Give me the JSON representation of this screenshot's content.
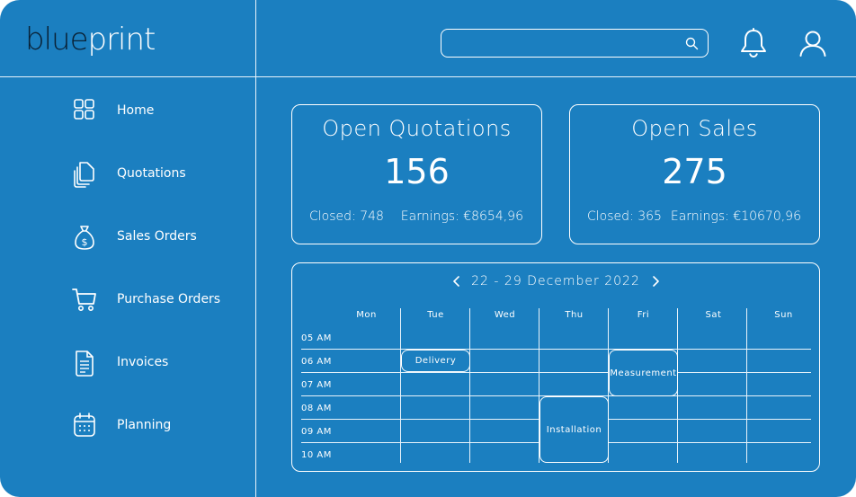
{
  "app": {
    "logo_part1": "blue",
    "logo_part2": "print"
  },
  "header": {
    "search_value": "",
    "search_placeholder": "",
    "icons": [
      "search-icon",
      "bell-icon",
      "user-icon"
    ]
  },
  "sidebar": {
    "items": [
      {
        "label": "Home",
        "icon": "grid-icon"
      },
      {
        "label": "Quotations",
        "icon": "documents-icon"
      },
      {
        "label": "Sales Orders",
        "icon": "money-bag-icon"
      },
      {
        "label": "Purchase Orders",
        "icon": "cart-icon"
      },
      {
        "label": "Invoices",
        "icon": "invoice-icon"
      },
      {
        "label": "Planning",
        "icon": "calendar-icon"
      }
    ]
  },
  "cards": {
    "quotations": {
      "title": "Open Quotations",
      "value": "156",
      "closed": "Closed: 748",
      "earnings": "Earnings: €8654,96"
    },
    "sales": {
      "title": "Open Sales",
      "value": "275",
      "closed": "Closed: 365",
      "earnings": "Earnings: €10670,96"
    }
  },
  "calendar": {
    "range": "22 - 29 December 2022",
    "days": [
      "Mon",
      "Tue",
      "Wed",
      "Thu",
      "Fri",
      "Sat",
      "Sun"
    ],
    "times": [
      "05 AM",
      "06 AM",
      "07 AM",
      "08 AM",
      "09 AM",
      "10 AM"
    ],
    "events": [
      {
        "label": "Delivery",
        "day": "Tue",
        "start": "06 AM",
        "end": "07 AM"
      },
      {
        "label": "Measurement",
        "day": "Fri",
        "start": "06 AM",
        "end": "08 AM"
      },
      {
        "label": "Installation",
        "day": "Thu",
        "start": "08 AM",
        "end": "10 AM"
      }
    ]
  },
  "colors": {
    "background": "#1b7fc0",
    "lines": "#ffffff",
    "logo_dark": "#0a2236"
  }
}
